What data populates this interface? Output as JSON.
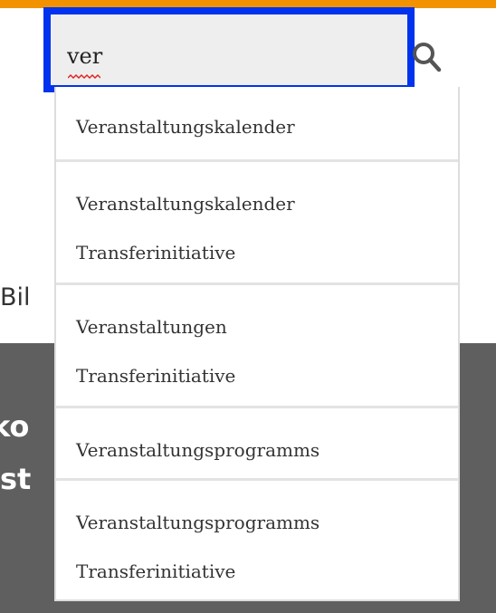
{
  "search": {
    "value": "ver",
    "placeholder": ""
  },
  "background": {
    "partial_text_1": "Bil",
    "partial_text_2": "ko",
    "partial_text_3": "st"
  },
  "suggestions": [
    {
      "line1": "Veranstaltungskalender",
      "line2": ""
    },
    {
      "line1": "Veranstaltungskalender",
      "line2": "Transferinitiative"
    },
    {
      "line1": "Veranstaltungen",
      "line2": "Transferinitiative"
    },
    {
      "line1": "Veranstaltungsprogramms",
      "line2": ""
    },
    {
      "line1": "Veranstaltungsprogramms",
      "line2": "Transferinitiative"
    }
  ],
  "colors": {
    "accent_bar": "#f39200",
    "focus_outline": "#0033ee",
    "dark_band": "#5f5f5f",
    "spellcheck_underline": "#e02020"
  },
  "icons": {
    "search": "search-icon"
  }
}
